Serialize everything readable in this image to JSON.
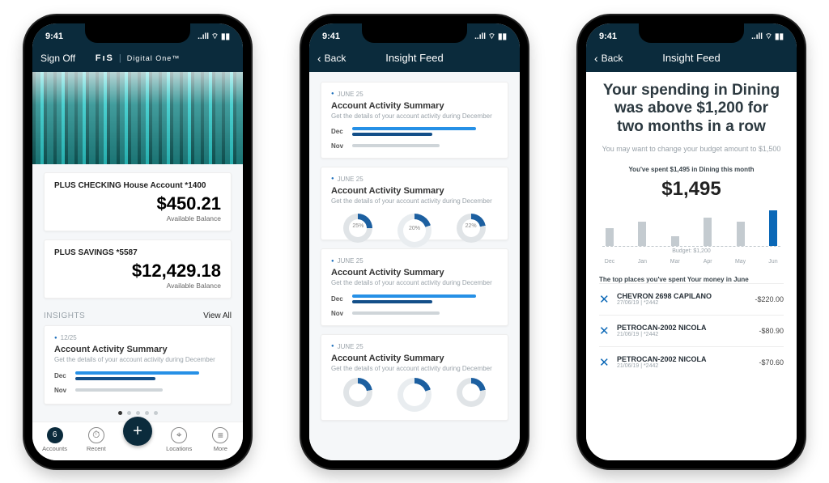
{
  "status_time": "9:41",
  "status_icons": "..ıll ⌔ ▮▮",
  "app": {
    "sign_off": "Sign Off",
    "brand": "FıS",
    "brand_sub": "Digital One™",
    "back": "Back",
    "insight_feed": "Insight Feed"
  },
  "accounts": [
    {
      "name": "PLUS CHECKING House Account *1400",
      "amount": "$450.21",
      "sub": "Available Balance"
    },
    {
      "name": "PLUS SAVINGS *5587",
      "amount": "$12,429.18",
      "sub": "Available Balance"
    }
  ],
  "insights_header": {
    "title": "INSIGHTS",
    "link": "View All"
  },
  "insight_card": {
    "date": "● 12/25",
    "title": "Account Activity Summary",
    "sub": "Get the details of your account activity during December",
    "rows": [
      {
        "label": "Dec"
      },
      {
        "label": "Nov"
      }
    ]
  },
  "feed_date": "JUNE 25",
  "feed_card_title": "Account Activity Summary",
  "feed_card_sub": "Get the details of your account activity during December",
  "feed_rows": [
    {
      "label": "Dec"
    },
    {
      "label": "Nov"
    }
  ],
  "donuts": [
    {
      "val": "25%"
    },
    {
      "val": "20%"
    },
    {
      "val": "22%"
    }
  ],
  "tabbar": [
    "Accounts",
    "Recent",
    "",
    "Locations",
    "More"
  ],
  "insight_detail": {
    "headline": "Your spending in Dining was above $1,200 for two months in a row",
    "subline": "You may want to change your budget amount to $1,500",
    "spent_label": "You've spent $1,495 in Dining this month",
    "spent_amount": "$1,495",
    "budget_line": "Budget: $1,200",
    "chart": {
      "labels": [
        "Dec",
        "Jan",
        "Mar",
        "Apr",
        "May",
        "Jun"
      ],
      "values": [
        22,
        30,
        12,
        35,
        30,
        44
      ],
      "highlight": 5
    },
    "top_places_label": "The top places you've spent Your money in June",
    "txns": [
      {
        "name": "CHEVRON 2698 CAPILANO",
        "meta": "27/06/19 | *2442",
        "amt": "-$220.00"
      },
      {
        "name": "PETROCAN-2002 NICOLA",
        "meta": "21/06/19 | *2442",
        "amt": "-$80.90"
      },
      {
        "name": "PETROCAN-2002 NICOLA",
        "meta": "21/06/19 | *2442",
        "amt": "-$70.60"
      }
    ]
  },
  "chart_data": {
    "type": "bar",
    "categories": [
      "Dec",
      "Jan",
      "Mar",
      "Apr",
      "May",
      "Jun"
    ],
    "values": [
      900,
      1100,
      600,
      1250,
      1100,
      1495
    ],
    "title": "You've spent $1,495 in Dining this month",
    "xlabel": "",
    "ylabel": "",
    "budget_line": 1200,
    "highlight_index": 5
  }
}
